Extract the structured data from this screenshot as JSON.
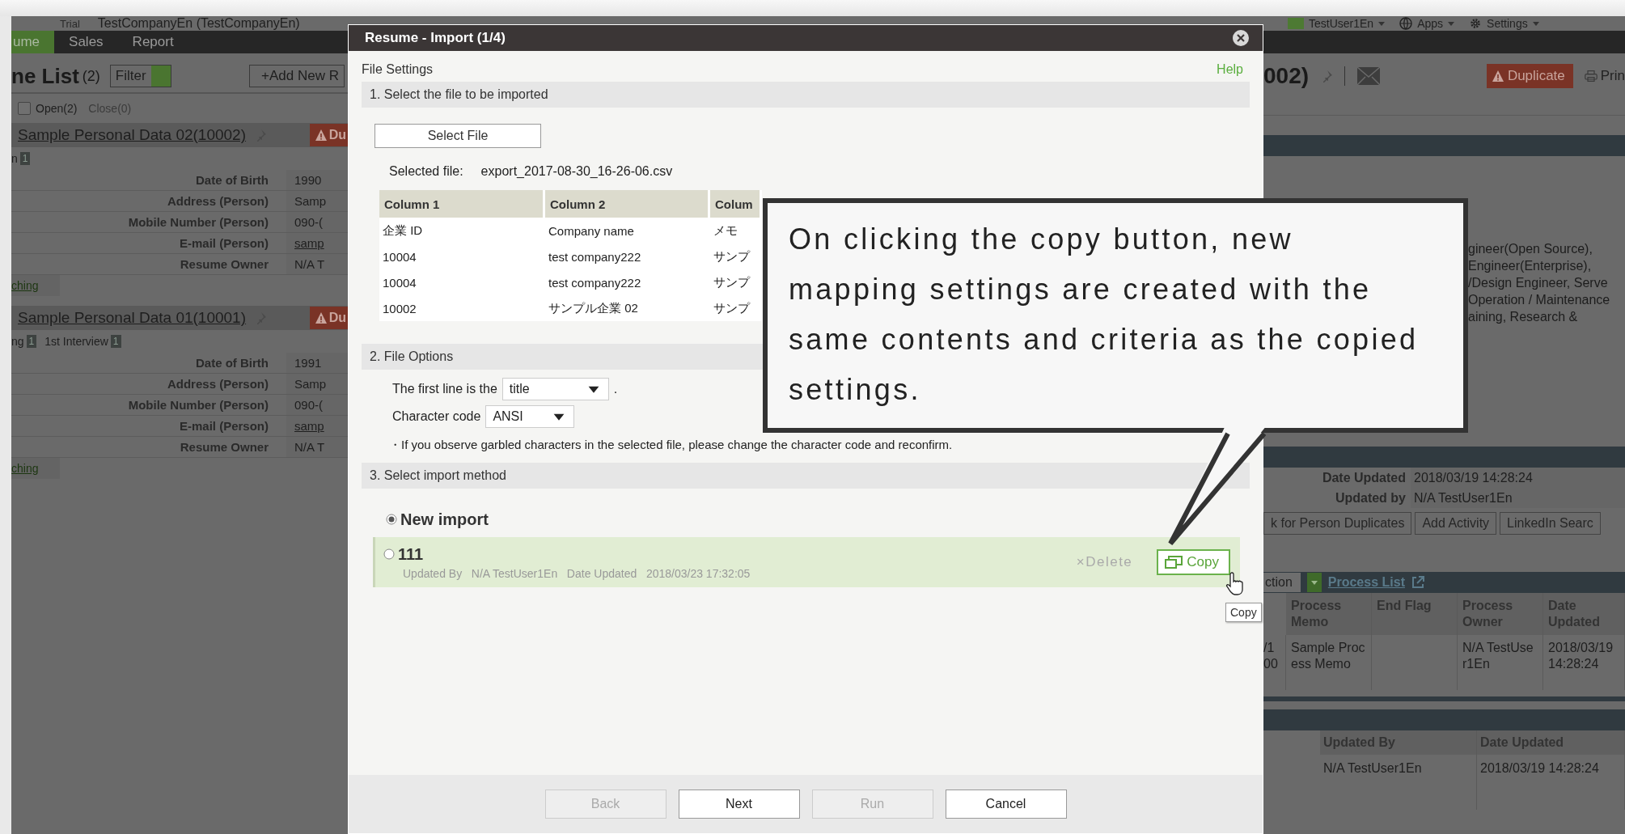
{
  "header": {
    "trial": "Trial",
    "company": "TestCompanyEn (TestCompanyEn)",
    "user_menus": [
      {
        "label": "TestUser1En"
      },
      {
        "label": "Apps"
      },
      {
        "label": "Settings"
      }
    ]
  },
  "nav_tabs": [
    {
      "label": "ume",
      "selected": true
    },
    {
      "label": "Sales",
      "selected": false
    },
    {
      "label": "Report",
      "selected": false
    }
  ],
  "list": {
    "title": "ne List",
    "count": "(2)",
    "filter_button": "Filter",
    "add_button": "+Add New R",
    "status_filters": [
      {
        "kind": "checkbox",
        "label": "Open(2)",
        "checked": false,
        "disabled": false
      },
      {
        "kind": "text",
        "label": "Close(0)",
        "disabled": true
      }
    ]
  },
  "records": [
    {
      "name": "Sample Personal Data 02(10002)",
      "badge": "Du",
      "stages": [
        {
          "label": "n",
          "count": "1"
        }
      ],
      "fields": [
        {
          "kind": "text",
          "label": "Date of Birth",
          "value": "1990"
        },
        {
          "kind": "text",
          "label": "Address (Person)",
          "value": "Samp"
        },
        {
          "kind": "text",
          "label": "Mobile Number (Person)",
          "value": "090-("
        },
        {
          "kind": "link",
          "label": "E-mail (Person)",
          "value": "samp"
        },
        {
          "kind": "text",
          "label": "Resume Owner",
          "value": "N/A T"
        }
      ],
      "link": "ching"
    },
    {
      "name": "Sample Personal Data 01(10001)",
      "badge": "Du",
      "stages": [
        {
          "label": "ng",
          "count": "1"
        },
        {
          "label": "1st Interview",
          "count": "1"
        }
      ],
      "fields": [
        {
          "kind": "text",
          "label": "Date of Birth",
          "value": "1991"
        },
        {
          "kind": "text",
          "label": "Address (Person)",
          "value": "Samp"
        },
        {
          "kind": "text",
          "label": "Mobile Number (Person)",
          "value": "090-("
        },
        {
          "kind": "link",
          "label": "E-mail (Person)",
          "value": "samp"
        },
        {
          "kind": "text",
          "label": "Resume Owner",
          "value": "N/A T"
        }
      ],
      "link": "ching"
    }
  ],
  "dialog": {
    "title": "Resume - Import (1/4)",
    "subtitle": "File Settings",
    "help": "Help",
    "file_section": {
      "heading": "1. Select the file to be imported",
      "select_button": "Select File",
      "selected_label": "Selected file:",
      "selected_file": "export_2017-08-30_16-26-06.csv",
      "preview": {
        "columns": [
          "Column 1",
          "Column 2",
          "Colum"
        ],
        "rows": [
          [
            "企業 ID",
            "Company name",
            "メモ"
          ],
          [
            "10004",
            "test company222",
            "サンプ"
          ],
          [
            "10004",
            "test company222",
            "サンプ"
          ],
          [
            "10002",
            "サンプル企業 02",
            "サンプ"
          ]
        ]
      }
    },
    "options_section": {
      "heading": "2. File Options",
      "first_line_label": "The first line is the",
      "first_line_value": "title",
      "first_line_suffix": ".",
      "charset_label": "Character code",
      "charset_value": "ANSI",
      "note": "・If you observe garbled characters in the selected file, please change the character code and reconfirm."
    },
    "import_section": {
      "heading": "3. Select import method",
      "methods": [
        {
          "kind": "new",
          "label": "New import",
          "selected": true
        },
        {
          "kind": "mapping",
          "label": "111",
          "selected": false,
          "highlighted": true,
          "meta": [
            {
              "label": "Updated By",
              "value": "N/A TestUser1En"
            },
            {
              "label": "Date Updated",
              "value": "2018/03/23 17:32:05"
            }
          ],
          "delete_label": "×Delete",
          "copy_label": "Copy"
        }
      ]
    },
    "footer_buttons": [
      {
        "label": "Back",
        "disabled": true
      },
      {
        "label": "Next",
        "disabled": false
      },
      {
        "label": "Run",
        "disabled": true
      },
      {
        "label": "Cancel",
        "disabled": false
      }
    ]
  },
  "callout": {
    "text": "On clicking the copy button, new mapping settings are created with the same contents and criteria as the copied settings."
  },
  "tooltip": {
    "text": "Copy"
  },
  "detail": {
    "title": "002)",
    "duplicate_button": "Duplicate",
    "print_button": "Prin",
    "job_lines": [
      "gineer(Open Source),",
      "Engineer(Enterprise),",
      "/Design Engineer, Serve",
      "Operation / Maintenance",
      "aining, Research &"
    ],
    "info_rows": [
      {
        "label": "Date Updated",
        "value": "2018/03/19 14:28:24"
      },
      {
        "label": "Updated by",
        "value": "N/A TestUser1En"
      }
    ],
    "action_buttons": [
      "k for Person Duplicates",
      "Add Activity",
      "LinkedIn Searc"
    ],
    "process": {
      "action_label": "ction",
      "link": "Process List",
      "columns": [
        "Process Memo",
        "End Flag",
        "Process Owner",
        "Date Updated"
      ],
      "rows": [
        {
          "lead_lines": [
            "/1",
            "00"
          ],
          "process_memo": "Sample Process Memo",
          "process_owner": "N/A TestUser1En",
          "date_updated": "2018/03/19 14:28:24"
        }
      ]
    },
    "history": {
      "columns": [
        "Updated By",
        "Date Updated"
      ],
      "rows": [
        [
          "N/A TestUser1En",
          "2018/03/19 14:28:24"
        ]
      ]
    }
  }
}
